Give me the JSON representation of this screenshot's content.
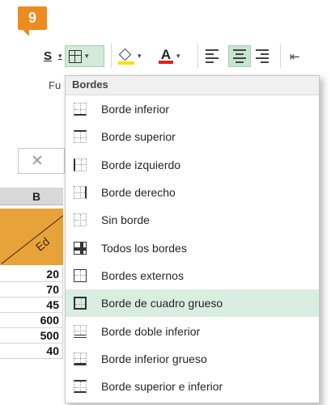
{
  "step_badge": "9",
  "ribbon": {
    "underline_label": "S",
    "dropdown_arrow": "▾",
    "indent_arrow": "⇤",
    "group_label_partial": "Fu"
  },
  "formula_bar": {
    "cancel_glyph": "✕"
  },
  "sheet": {
    "column_header": "B",
    "header_cell_text": "Ed",
    "values": [
      "20",
      "70",
      "45",
      "600",
      "500",
      "40"
    ]
  },
  "dropdown": {
    "title": "Bordes",
    "items": [
      {
        "label": "Borde inferior",
        "icon": "border-bottom-icon"
      },
      {
        "label": "Borde superior",
        "icon": "border-top-icon"
      },
      {
        "label": "Borde izquierdo",
        "icon": "border-left-icon"
      },
      {
        "label": "Borde derecho",
        "icon": "border-right-icon"
      },
      {
        "label": "Sin borde",
        "icon": "no-border-icon"
      },
      {
        "label": "Todos los bordes",
        "icon": "all-borders-icon"
      },
      {
        "label": "Bordes externos",
        "icon": "outside-borders-icon"
      },
      {
        "label": "Borde de cuadro grueso",
        "icon": "thick-box-border-icon",
        "selected": true
      },
      {
        "label": "Borde doble inferior",
        "icon": "double-bottom-border-icon"
      },
      {
        "label": "Borde inferior grueso",
        "icon": "thick-bottom-border-icon"
      },
      {
        "label": "Borde superior e inferior",
        "icon": "top-bottom-border-icon"
      }
    ]
  },
  "colors": {
    "badge": "#ed8b1f",
    "selected_bg": "#d9ede0",
    "header_cell": "#e8a23a",
    "font_color_bar": "#e0231a",
    "fill_color_bar": "#f5e200"
  }
}
